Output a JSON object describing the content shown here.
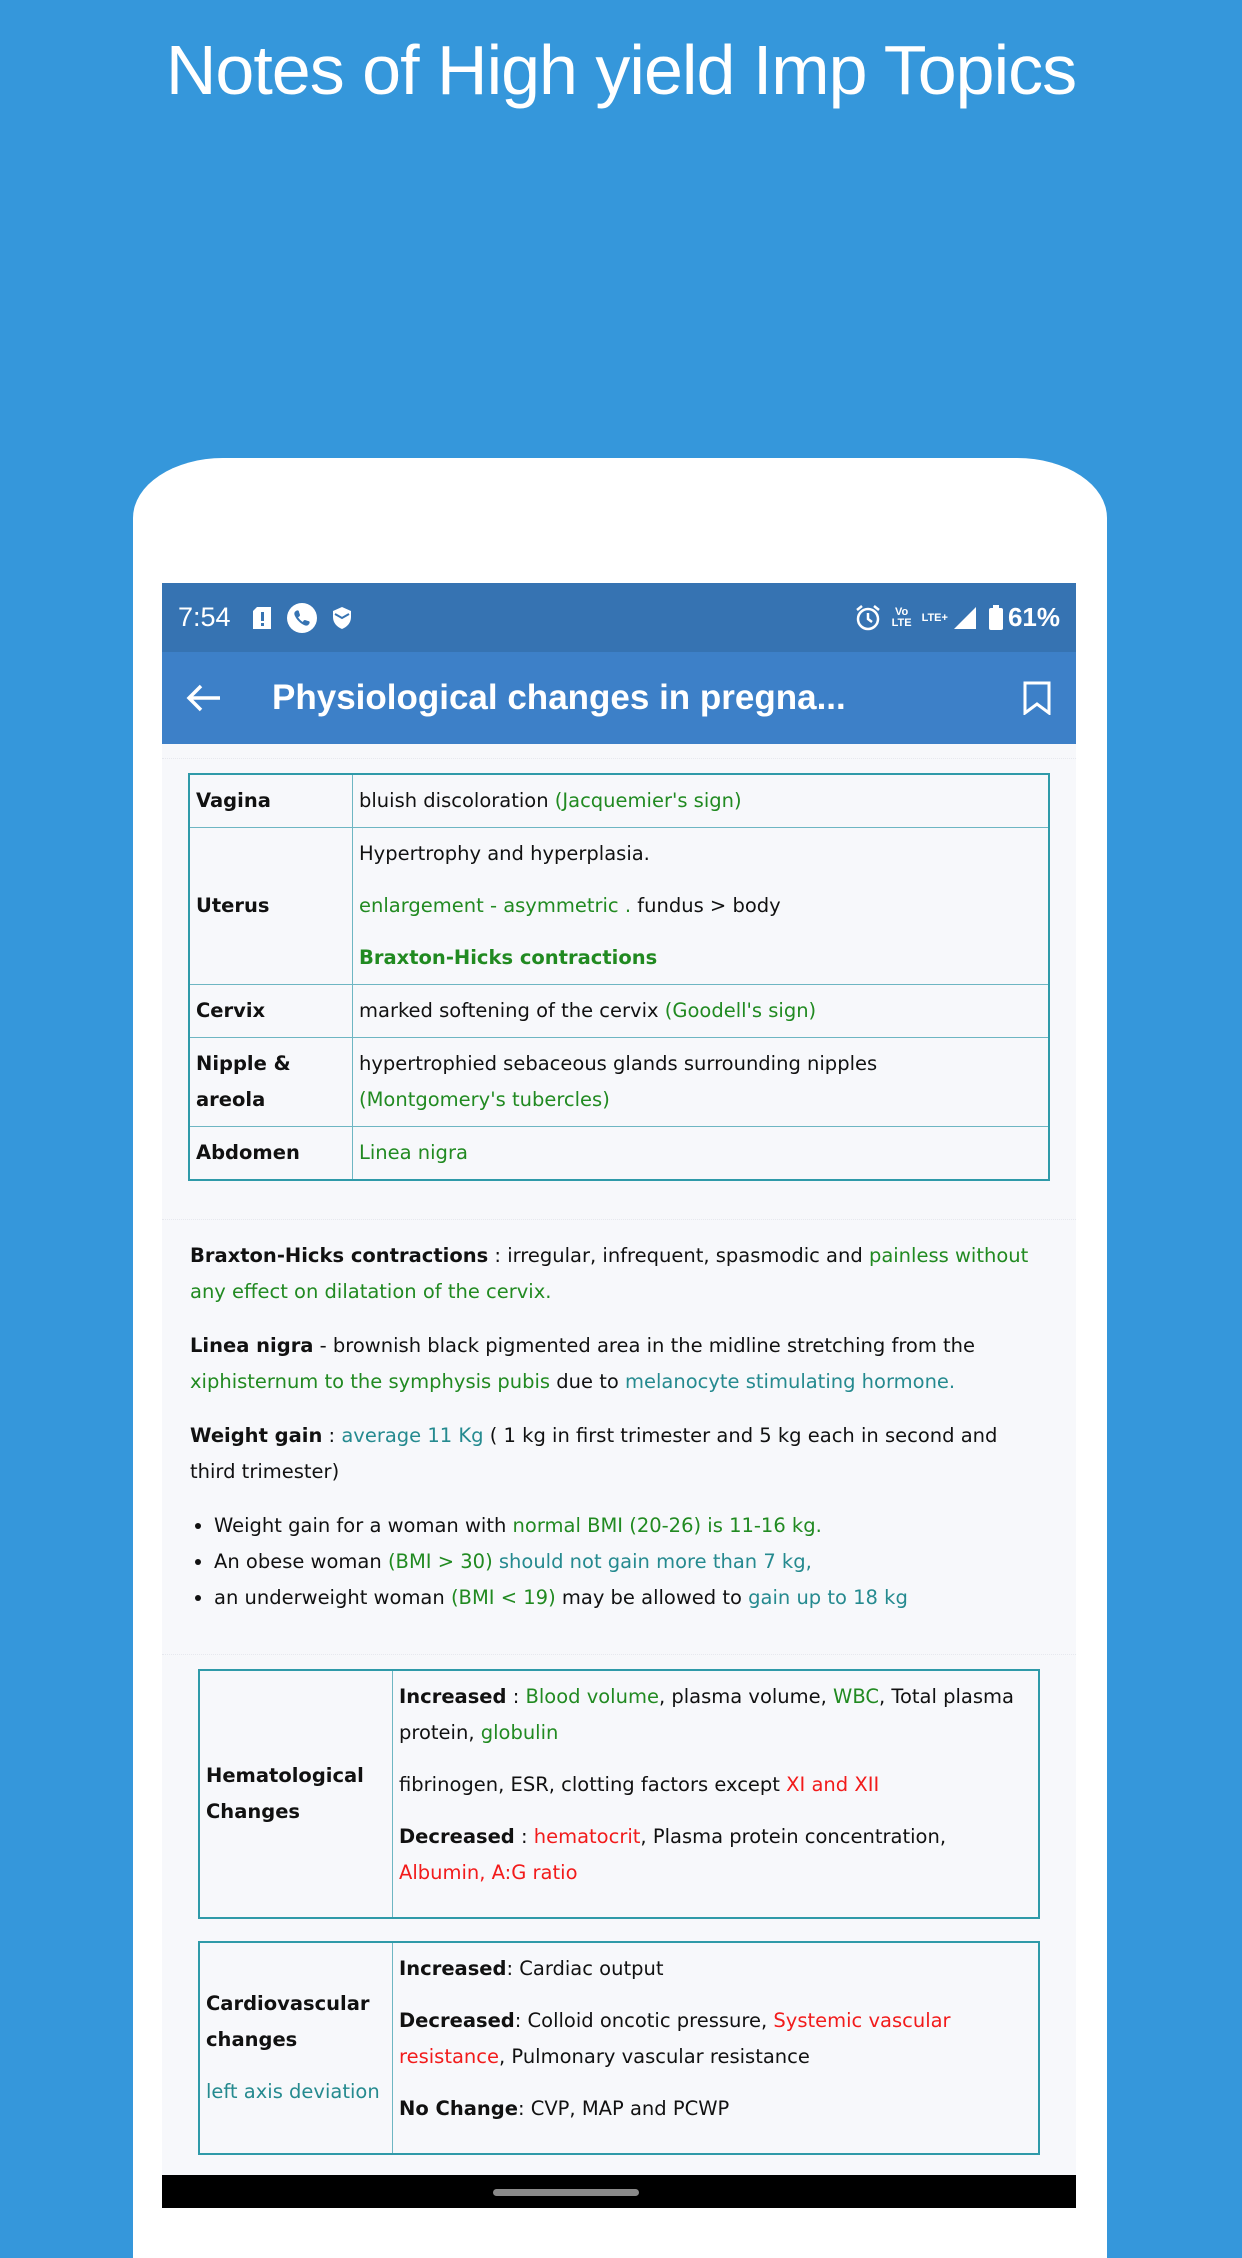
{
  "promo": {
    "title": "Notes of High yield Imp Topics"
  },
  "statusbar": {
    "time": "7:54",
    "left_icons": [
      "sim-alert-icon",
      "phone-call-icon",
      "shield-icon"
    ],
    "right_icons": [
      "alarm-icon",
      "volte-icon",
      "lte-plus-icon",
      "signal-icon",
      "battery-icon"
    ],
    "volte_top": "Vo",
    "volte_bottom": "LTE",
    "lte_plus": "LTE+",
    "battery": "61%"
  },
  "appbar": {
    "title": "Physiological changes in pregna...",
    "back_icon": "arrow-back-icon",
    "bookmark_icon": "bookmark-icon"
  },
  "table1": {
    "rows": [
      {
        "head": "Vagina",
        "parts": [
          "bluish discoloration ",
          "(Jacquemier's sign)"
        ]
      },
      {
        "head": "Uterus",
        "line1": "Hypertrophy and hyperplasia.",
        "line2_green": "enlargement - asymmetric .",
        "line2_black": " fundus > body",
        "line3": "Braxton-Hicks contractions"
      },
      {
        "head": "Cervix",
        "parts": [
          "marked softening of the cervix ",
          "(Goodell's sign)"
        ]
      },
      {
        "head": "Nipple & areola",
        "parts": [
          "hypertrophied sebaceous glands surrounding nipples",
          "(Montgomery's tubercles)"
        ]
      },
      {
        "head": "Abdomen",
        "parts": [
          "Linea nigra"
        ]
      }
    ]
  },
  "paragraphs": {
    "braxton": {
      "label": "Braxton-Hicks contractions",
      "sep": " : ",
      "text": "irregular, infrequent, spasmodic and ",
      "green": "painless without any effect on dilatation of the cervix."
    },
    "linea": {
      "label": "Linea nigra",
      "sep": " - ",
      "text": "brownish black pigmented area in the midline stretching from the ",
      "green": "xiphisternum to the symphysis pubis",
      "mid": " due to ",
      "teal": "melanocyte stimulating hormone."
    },
    "weight": {
      "label": "Weight gain",
      "sep": " : ",
      "teal": "average 11 Kg",
      "text": " ( 1 kg in first trimester and 5 kg each in second and third trimester)"
    }
  },
  "bullets": [
    {
      "a": "Weight gain for a woman with ",
      "b": "normal BMI (20-26) is 11-16 kg."
    },
    {
      "a": "An obese woman ",
      "b": "(BMI > 30)",
      "c": " should not gain more than 7 kg,"
    },
    {
      "a": "an underweight woman ",
      "b": "(BMI < 19)",
      "c": " may be allowed to ",
      "d": "gain up to 18 kg"
    }
  ],
  "table2": {
    "head": "Hematological Changes",
    "increased_label": "Increased",
    "sep": " : ",
    "inc_1": "Blood volume",
    "inc_2": ", plasma volume, ",
    "inc_3": "WBC",
    "inc_4": ", Total plasma protein, ",
    "inc_5": "globulin",
    "fib_text": "fibrinogen, ESR, clotting factors except ",
    "fib_red": "XI and XII",
    "decreased_label": "Decreased",
    "dec_1": "hematocrit",
    "dec_2": ", Plasma protein concentration, ",
    "dec_3": "Albumin, A:G ratio"
  },
  "table3": {
    "head": "Cardiovascular changes",
    "sub": "left axis deviation",
    "increased_label": "Increased",
    "inc_text": " Cardiac output",
    "decreased_label": "Decreased",
    "dec_1": " Colloid oncotic pressure, ",
    "dec_red": "Systemic vascular resistance",
    "dec_2": ", Pulmonary vascular resistance",
    "nochange_label": "No Change",
    "nochange_text": " CVP, MAP and PCWP"
  }
}
